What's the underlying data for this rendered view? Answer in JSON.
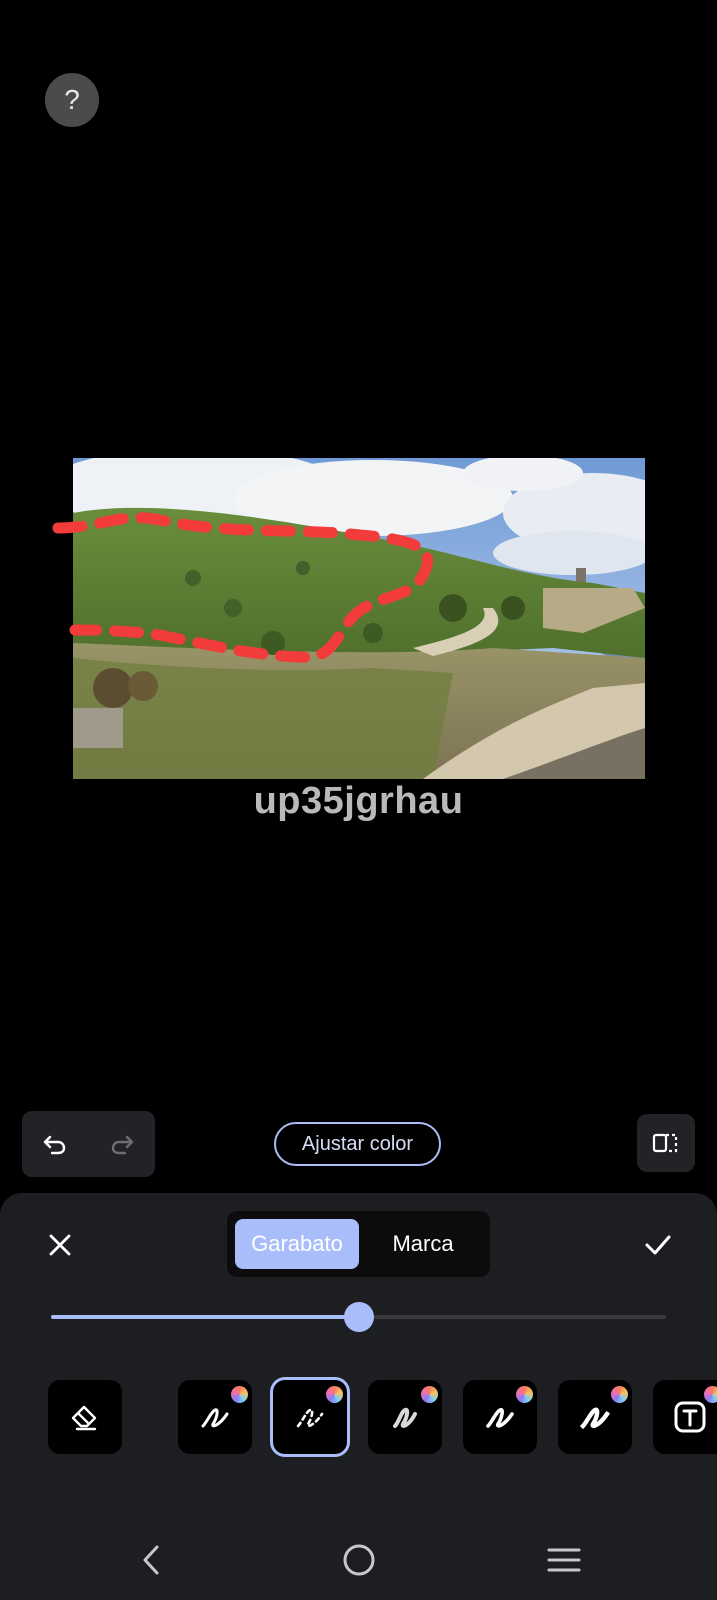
{
  "top": {
    "help_label": "?"
  },
  "photo": {
    "watermark_text": "up35jgrhau",
    "scribble_color": "#f23b3b"
  },
  "toolbar": {
    "adjust_label": "Ajustar color"
  },
  "panel": {
    "segments": {
      "active": "Garabato",
      "inactive": "Marca"
    },
    "stroke_slider_fraction": 0.5,
    "tools": [
      {
        "icon": "eraser-icon"
      },
      {
        "icon": "pen-solid-icon"
      },
      {
        "icon": "pen-dashed-icon",
        "selected": true
      },
      {
        "icon": "pen-soft-icon"
      },
      {
        "icon": "pen-marker-icon"
      },
      {
        "icon": "pen-highlighter-icon"
      },
      {
        "icon": "text-tool-icon"
      }
    ]
  },
  "accent_color": "#a9bdfa",
  "nav": {
    "icons": [
      "back-icon",
      "home-icon",
      "recents-icon"
    ]
  }
}
